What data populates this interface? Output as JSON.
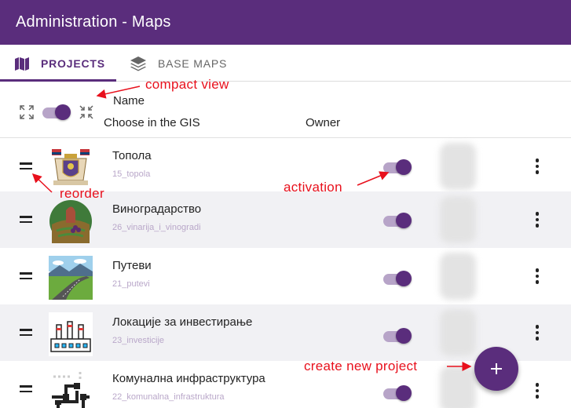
{
  "app": {
    "title": "Administration - Maps"
  },
  "tabs": [
    {
      "label": "PROJECTS",
      "icon": "map-icon",
      "active": true
    },
    {
      "label": "BASE MAPS",
      "icon": "layers-icon",
      "active": false
    }
  ],
  "table_header": {
    "col_name": "Name",
    "col_choose": "Choose in the GIS",
    "col_owner": "Owner",
    "compact_toggle_on": true
  },
  "rows": [
    {
      "name": "Топола",
      "code": "15_topola",
      "active": true,
      "thumbnail": "coat-of-arms"
    },
    {
      "name": "Виноградарство",
      "code": "26_vinarija_i_vinogradi",
      "active": true,
      "thumbnail": "vineyard"
    },
    {
      "name": "Путеви",
      "code": "21_putevi",
      "active": true,
      "thumbnail": "road-landscape"
    },
    {
      "name": "Локације за инвестирање",
      "code": "23_investicije",
      "active": true,
      "thumbnail": "factory"
    },
    {
      "name": "Комунална инфраструктура",
      "code": "22_komunalna_infrastruktura",
      "active": true,
      "thumbnail": "pipes"
    }
  ],
  "annotations": {
    "compact_view": "compact view",
    "reorder": "reorder",
    "activation": "activation",
    "create_new_project": "create new project"
  },
  "colors": {
    "primary": "#5a2d7c",
    "annotation": "#e8101c"
  }
}
